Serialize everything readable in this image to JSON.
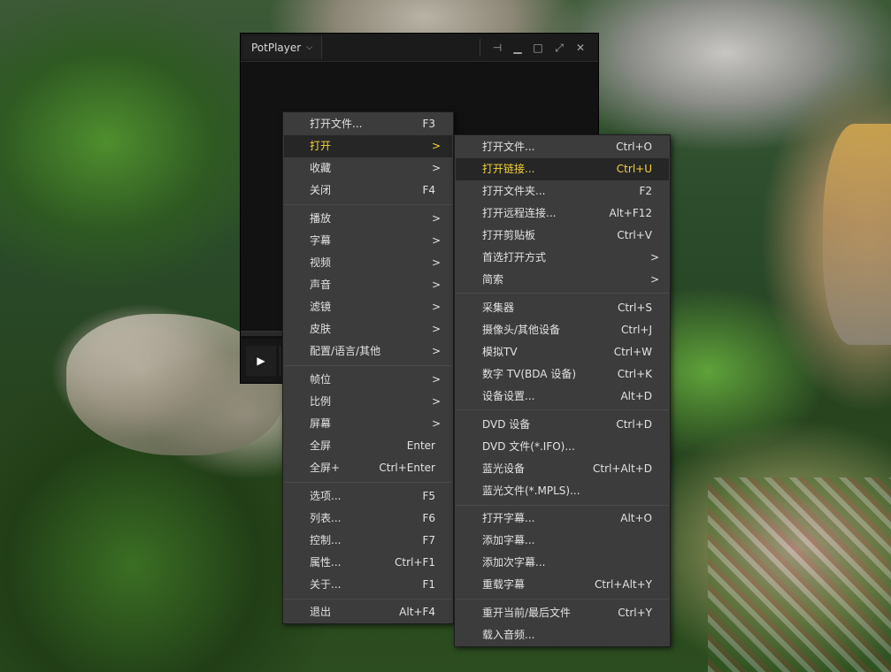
{
  "player": {
    "title": "PotPlayer",
    "title_chevron": "⌵",
    "controls": {
      "pin": "⊣",
      "minimize": "▁",
      "maximize": "□",
      "fullscreen": "⤢",
      "close": "✕"
    },
    "play_glyph": "▶"
  },
  "main_menu": {
    "items": [
      {
        "label": "打开文件...",
        "shortcut": "F3"
      },
      {
        "label": "打开",
        "shortcut": ">"
      },
      {
        "label": "收藏",
        "shortcut": ">"
      },
      {
        "label": "关闭",
        "shortcut": "F4"
      },
      {
        "label": "播放",
        "shortcut": ">"
      },
      {
        "label": "字幕",
        "shortcut": ">"
      },
      {
        "label": "视频",
        "shortcut": ">"
      },
      {
        "label": "声音",
        "shortcut": ">"
      },
      {
        "label": "滤镜",
        "shortcut": ">"
      },
      {
        "label": "皮肤",
        "shortcut": ">"
      },
      {
        "label": "配置/语言/其他",
        "shortcut": ">"
      },
      {
        "label": "帧位",
        "shortcut": ">"
      },
      {
        "label": "比例",
        "shortcut": ">"
      },
      {
        "label": "屏幕",
        "shortcut": ">"
      },
      {
        "label": "全屏",
        "shortcut": "Enter"
      },
      {
        "label": "全屏+",
        "shortcut": "Ctrl+Enter"
      },
      {
        "label": "选项...",
        "shortcut": "F5"
      },
      {
        "label": "列表...",
        "shortcut": "F6"
      },
      {
        "label": "控制...",
        "shortcut": "F7"
      },
      {
        "label": "属性...",
        "shortcut": "Ctrl+F1"
      },
      {
        "label": "关于...",
        "shortcut": "F1"
      },
      {
        "label": "退出",
        "shortcut": "Alt+F4"
      }
    ]
  },
  "open_submenu": {
    "items": [
      {
        "label": "打开文件...",
        "shortcut": "Ctrl+O"
      },
      {
        "label": "打开链接...",
        "shortcut": "Ctrl+U"
      },
      {
        "label": "打开文件夹...",
        "shortcut": "F2"
      },
      {
        "label": "打开远程连接...",
        "shortcut": "Alt+F12"
      },
      {
        "label": "打开剪贴板",
        "shortcut": "Ctrl+V"
      },
      {
        "label": "首选打开方式",
        "shortcut": ">"
      },
      {
        "label": "简索",
        "shortcut": ">"
      },
      {
        "label": "采集器",
        "shortcut": "Ctrl+S"
      },
      {
        "label": "摄像头/其他设备",
        "shortcut": "Ctrl+J"
      },
      {
        "label": "模拟TV",
        "shortcut": "Ctrl+W"
      },
      {
        "label": "数字 TV(BDA 设备)",
        "shortcut": "Ctrl+K"
      },
      {
        "label": "设备设置...",
        "shortcut": "Alt+D"
      },
      {
        "label": "DVD 设备",
        "shortcut": "Ctrl+D"
      },
      {
        "label": "DVD 文件(*.IFO)...",
        "shortcut": ""
      },
      {
        "label": "蓝光设备",
        "shortcut": "Ctrl+Alt+D"
      },
      {
        "label": "蓝光文件(*.MPLS)...",
        "shortcut": ""
      },
      {
        "label": "打开字幕...",
        "shortcut": "Alt+O"
      },
      {
        "label": "添加字幕...",
        "shortcut": ""
      },
      {
        "label": "添加次字幕...",
        "shortcut": ""
      },
      {
        "label": "重载字幕",
        "shortcut": "Ctrl+Alt+Y"
      },
      {
        "label": "重开当前/最后文件",
        "shortcut": "Ctrl+Y"
      },
      {
        "label": "载入音频...",
        "shortcut": ""
      }
    ]
  },
  "colors": {
    "menu_bg": "#3c3c3c",
    "highlight_bg": "#262626",
    "highlight_text": "#f5d33a",
    "menu_text": "#e2e2e2"
  }
}
